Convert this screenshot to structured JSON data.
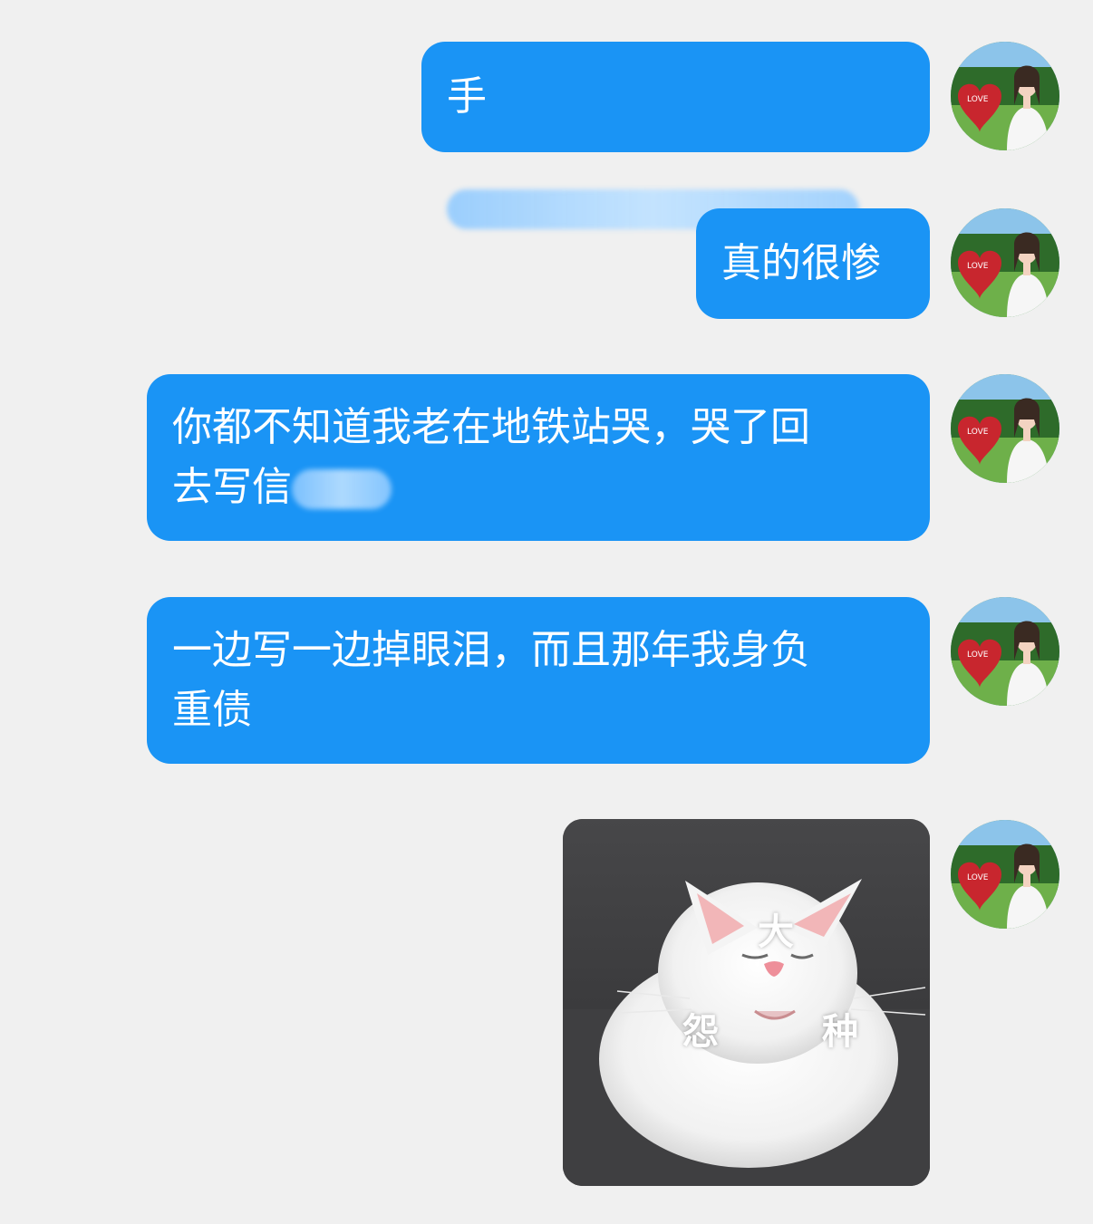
{
  "chat": {
    "messages": [
      {
        "id": "m1",
        "type": "text",
        "text": "手",
        "redacted": true
      },
      {
        "id": "m2",
        "type": "text",
        "text": "真的很惨"
      },
      {
        "id": "m3",
        "type": "text",
        "line1": "你都不知道我老在地铁站哭，哭了回",
        "line2": "去写信",
        "redacted": true
      },
      {
        "id": "m4",
        "type": "text",
        "line1": "一边写一边掉眼泪，而且那年我身负",
        "line2": "重债"
      },
      {
        "id": "m5",
        "type": "sticker",
        "subject": "white-cat-icon",
        "caption_top": "大",
        "caption_left": "怨",
        "caption_right": "种"
      }
    ],
    "colors": {
      "background": "#f0f0f0",
      "bubble": "#1a94f5",
      "bubble_text": "#ffffff"
    }
  }
}
